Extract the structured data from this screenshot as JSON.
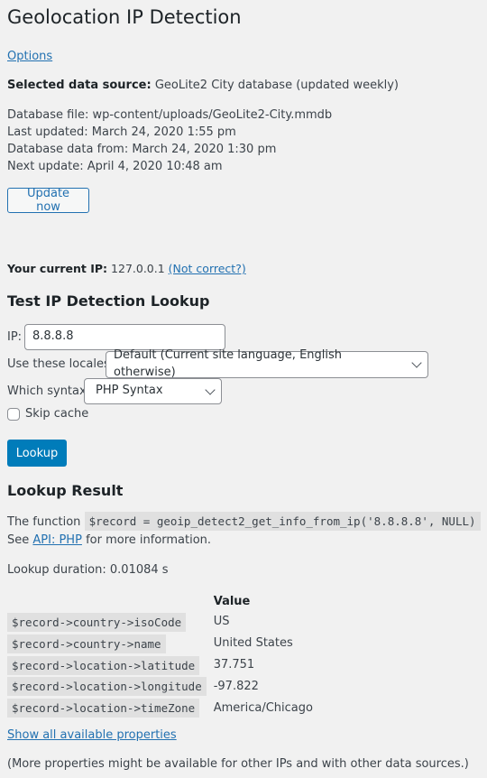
{
  "page": {
    "title": "Geolocation IP Detection",
    "options_link": "Options"
  },
  "datasource": {
    "label": "Selected data source:",
    "value": "GeoLite2 City database (updated weekly)"
  },
  "database": {
    "file": "Database file: wp-content/uploads/GeoLite2-City.mmdb",
    "last_updated": "Last updated: March 24, 2020 1:55 pm",
    "data_from": "Database data from: March 24, 2020 1:30 pm",
    "next_update": "Next update: April 4, 2020 10:48 am",
    "update_button": "Update now"
  },
  "current_ip": {
    "label": "Your current IP:",
    "value": "127.0.0.1",
    "not_correct_link": "(Not correct?)"
  },
  "test": {
    "heading": "Test IP Detection Lookup",
    "ip_label": "IP:",
    "ip_value": "8.8.8.8",
    "locales_label": "Use these locales:",
    "locales_selected": "Default (Current site language, English otherwise)",
    "syntax_label": "Which syntax:",
    "syntax_selected": "PHP Syntax",
    "skip_cache_label": "Skip cache",
    "skip_cache_checked": false,
    "lookup_button": "Lookup"
  },
  "result": {
    "heading": "Lookup Result",
    "function_prefix": "The function",
    "function_code": "$record = geoip_detect2_get_info_from_ip('8.8.8.8', NULL)",
    "see_prefix": "See",
    "api_link": "API: PHP",
    "see_suffix": "for more information.",
    "duration": "Lookup duration: 0.01084 s",
    "table": {
      "value_header": "Value",
      "rows": [
        {
          "key": "$record->country->isoCode",
          "value": "US"
        },
        {
          "key": "$record->country->name",
          "value": "United States"
        },
        {
          "key": "$record->location->latitude",
          "value": "37.751"
        },
        {
          "key": "$record->location->longitude",
          "value": "-97.822"
        },
        {
          "key": "$record->location->timeZone",
          "value": "America/Chicago"
        }
      ]
    },
    "show_all_link": "Show all available properties",
    "footnote": "(More properties might be available for other IPs and with other data sources.)"
  }
}
